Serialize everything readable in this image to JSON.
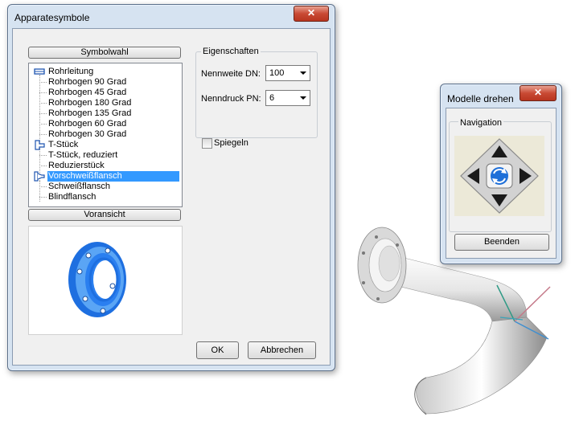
{
  "dialog": {
    "title": "Apparatesymbole",
    "close_label": "✕",
    "symbolwahl_label": "Symbolwahl",
    "tree_items": [
      {
        "label": "Rohrleitung"
      },
      {
        "label": "Rohrbogen 90 Grad"
      },
      {
        "label": "Rohrbogen 45 Grad"
      },
      {
        "label": "Rohrbogen 180 Grad"
      },
      {
        "label": "Rohrbogen 135 Grad"
      },
      {
        "label": "Rohrbogen 60 Grad"
      },
      {
        "label": "Rohrbogen 30 Grad"
      },
      {
        "label": "T-Stück"
      },
      {
        "label": "T-Stück, reduziert"
      },
      {
        "label": "Reduzierstück"
      },
      {
        "label": "Vorschweißflansch"
      },
      {
        "label": "Schweißflansch"
      },
      {
        "label": "Blindflansch"
      }
    ],
    "voransicht_label": "Voransicht",
    "eigenschaften_label": "Eigenschaften",
    "nennweite_label": "Nennweite DN:",
    "nennweite_value": "100",
    "nenndruck_label": "Nenndruck PN:",
    "nenndruck_value": "6",
    "spiegeln_label": "Spiegeln",
    "ok_label": "OK",
    "abbrechen_label": "Abbrechen"
  },
  "rotate": {
    "title": "Modelle drehen",
    "close_label": "✕",
    "navigation_label": "Navigation",
    "beenden_label": "Beenden"
  },
  "colors": {
    "selection": "#3399ff",
    "flange_blue": "#1e6fe0",
    "close_red": "#c94a34"
  }
}
